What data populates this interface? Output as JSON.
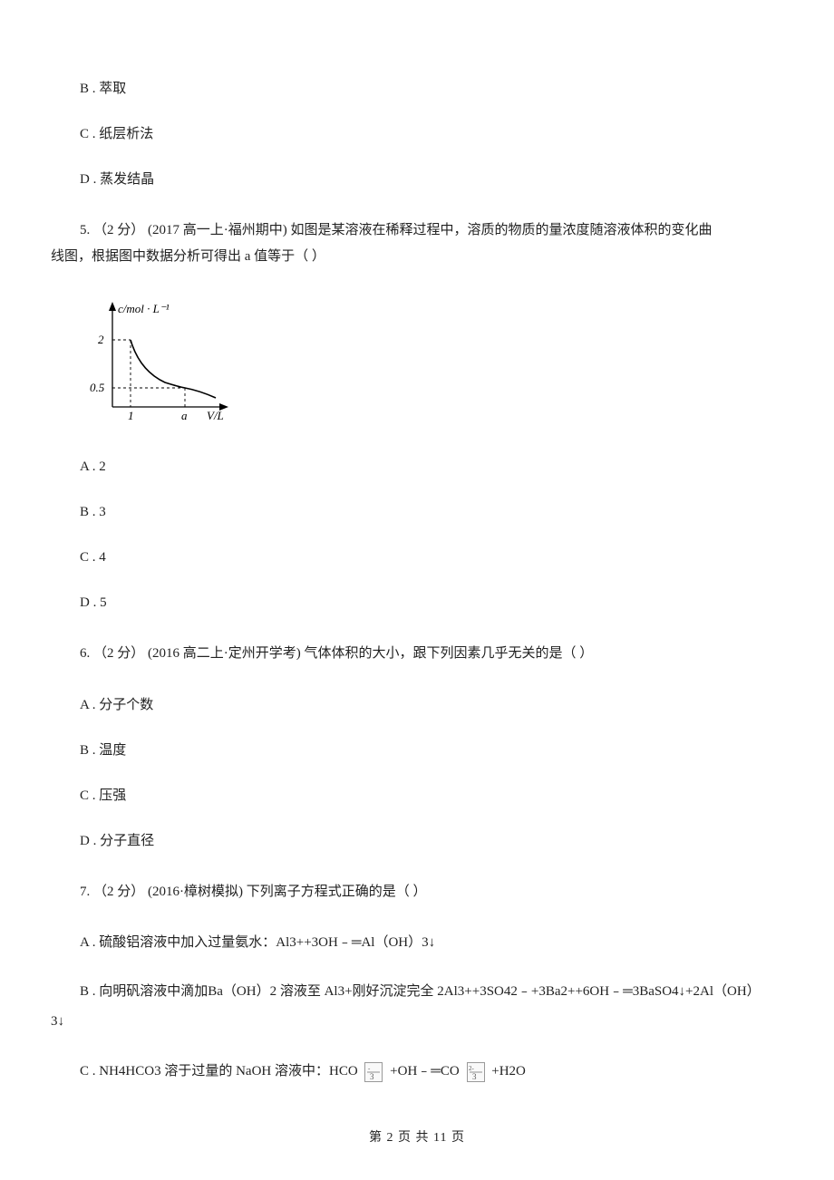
{
  "opts_prev": {
    "b": "B .  萃取",
    "c": "C .  纸层析法",
    "d": "D .  蒸发结晶"
  },
  "q5": {
    "line1": "5.  （2 分） (2017 高一上·福州期中)  如图是某溶液在稀释过程中，溶质的物质的量浓度随溶液体积的变化曲",
    "line2": "线图，根据图中数据分析可得出 a 值等于（      ）",
    "a": "A .  2",
    "b": "B .  3",
    "c": "C .  4",
    "d": "D .  5"
  },
  "chart_data": {
    "type": "line",
    "title": "",
    "xlabel": "V/L",
    "ylabel": "c/mol·L⁻¹",
    "x_ticks": [
      "1",
      "a"
    ],
    "y_ticks": [
      "0.5",
      "2"
    ],
    "marked_points": [
      {
        "x": 1,
        "y": 2
      },
      {
        "x": "a",
        "y": 0.5
      }
    ],
    "curve_shape": "decreasing-convex (dilution c=const/V)",
    "note": "Curve passes through (1,2) and (a,0.5). Dashed guide lines from (1,2) to axes and from (a,0.5) to axes."
  },
  "q6": {
    "line": "6.  （2 分）  (2016 高二上·定州开学考)  气体体积的大小，跟下列因素几乎无关的是（      ）",
    "a": "A .  分子个数",
    "b": "B .  温度",
    "c": "C .  压强",
    "d": "D .  分子直径"
  },
  "q7": {
    "line": "7.  （2 分）  (2016·樟树模拟)  下列离子方程式正确的是（      ）",
    "a": "A .  硫酸铝溶液中加入过量氨水：Al3++3OH﹣═Al（OH）3↓",
    "b_line1": "B .   向明矾溶液中滴加Ba（OH）2 溶液至 Al3+刚好沉淀完全  2Al3++3SO42﹣+3Ba2++6OH﹣═3BaSO4↓+2Al（OH）",
    "b_line2": "3↓",
    "c_pre": "C .  NH4HCO3 溶于过量的 NaOH 溶液中：HCO ",
    "c_mid": " +OH﹣═CO ",
    "c_post": " +H2O"
  },
  "footer": {
    "text": "第  2  页  共  11  页"
  }
}
